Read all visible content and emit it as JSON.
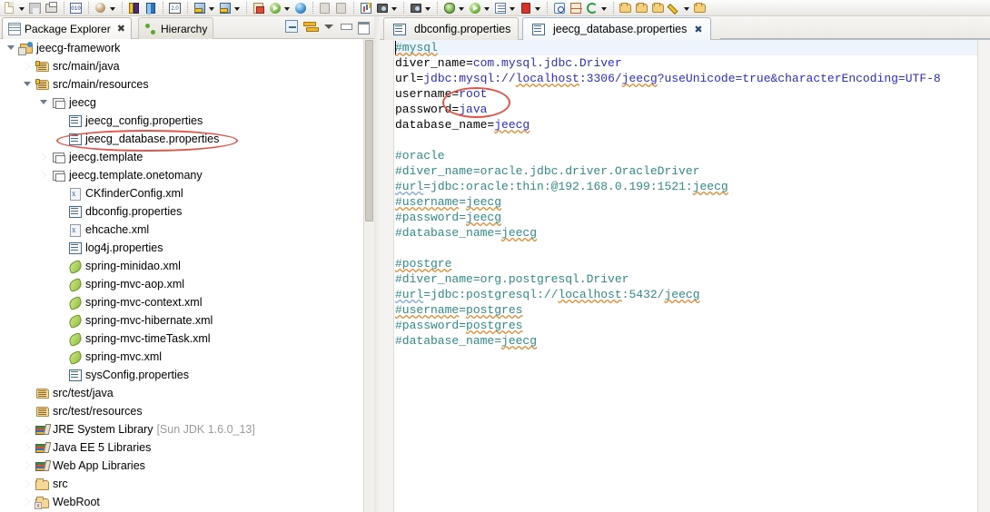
{
  "toolbar": {
    "groups": [
      {
        "items": [
          {
            "icon": "new-file-icon",
            "arrow": true
          },
          {
            "icon": "save-icon",
            "arrow": false
          },
          {
            "icon": "print-icon",
            "arrow": false
          }
        ]
      },
      {
        "items": [
          {
            "icon": "binary-010-icon",
            "arrow": false
          }
        ]
      },
      {
        "items": [
          {
            "icon": "package-ball-icon",
            "arrow": true
          }
        ]
      },
      {
        "items": [
          {
            "icon": "book-yellow-purple-icon",
            "arrow": false
          },
          {
            "icon": "book-blue-icon",
            "arrow": false
          }
        ]
      },
      {
        "items": [
          {
            "icon": "version-2-0-icon",
            "arrow": false
          }
        ]
      },
      {
        "items": [
          {
            "icon": "new-java-class-icon",
            "arrow": true
          },
          {
            "icon": "new-java-project-icon",
            "arrow": true
          }
        ]
      },
      {
        "items": [
          {
            "icon": "new-wizard-icon",
            "arrow": false
          },
          {
            "icon": "run-server-icon",
            "arrow": true
          },
          {
            "icon": "open-browser-icon",
            "arrow": false
          }
        ]
      },
      {
        "items": [
          {
            "icon": "grey-disabled-icon",
            "arrow": false
          },
          {
            "icon": "grey-disabled-2-icon",
            "arrow": false
          }
        ]
      },
      {
        "items": [
          {
            "icon": "chart-icon",
            "arrow": false
          },
          {
            "icon": "camera-icon",
            "arrow": true
          }
        ]
      },
      {
        "items": [
          {
            "icon": "device-icon",
            "arrow": true
          }
        ]
      },
      {
        "items": [
          {
            "icon": "debug-bug-icon",
            "arrow": true
          },
          {
            "icon": "run-green-icon",
            "arrow": true
          },
          {
            "icon": "external-tools-icon",
            "arrow": true
          },
          {
            "icon": "lock-red-icon",
            "arrow": true
          }
        ]
      },
      {
        "items": [
          {
            "icon": "search-icon",
            "arrow": false
          },
          {
            "icon": "grid-icon",
            "arrow": false
          },
          {
            "icon": "refresh-green-icon",
            "arrow": true
          }
        ]
      },
      {
        "items": [
          {
            "icon": "open-folder-icon",
            "arrow": false
          },
          {
            "icon": "open-folder-2-icon",
            "arrow": false
          },
          {
            "icon": "open-folder-3-icon",
            "arrow": false
          },
          {
            "icon": "pencil-icon",
            "arrow": true
          },
          {
            "icon": "open-folder-4-icon",
            "arrow": false
          }
        ]
      }
    ]
  },
  "left_panel": {
    "tabs": [
      {
        "label": "Package Explorer",
        "icon": "package-explorer-icon",
        "active": true,
        "closable": true
      },
      {
        "label": "Hierarchy",
        "icon": "hierarchy-icon",
        "active": false,
        "closable": false
      }
    ],
    "toolbar_buttons": [
      {
        "name": "collapse-all-button",
        "tooltip": "Collapse All"
      },
      {
        "name": "link-with-editor-button",
        "tooltip": "Link with Editor"
      },
      {
        "name": "view-menu-button",
        "tooltip": "View Menu"
      },
      {
        "name": "minimize-button",
        "tooltip": "Minimize"
      },
      {
        "name": "maximize-button",
        "tooltip": "Maximize"
      }
    ],
    "tree": [
      {
        "label": "jeecg-framework",
        "indent": 0,
        "twisty": "open",
        "icon": "java-project-icon"
      },
      {
        "label": "src/main/java",
        "indent": 1,
        "twisty": "closed",
        "icon": "source-folder-icon"
      },
      {
        "label": "src/main/resources",
        "indent": 1,
        "twisty": "open",
        "icon": "source-folder-icon"
      },
      {
        "label": "jeecg",
        "indent": 2,
        "twisty": "open",
        "icon": "package-icon"
      },
      {
        "label": "jeecg_config.properties",
        "indent": 3,
        "twisty": "none",
        "icon": "properties-file-icon"
      },
      {
        "label": "jeecg_database.properties",
        "indent": 3,
        "twisty": "none",
        "icon": "properties-file-icon",
        "selected": true
      },
      {
        "label": "jeecg.template",
        "indent": 2,
        "twisty": "closed",
        "icon": "package-icon"
      },
      {
        "label": "jeecg.template.onetomany",
        "indent": 2,
        "twisty": "closed",
        "icon": "package-icon"
      },
      {
        "label": "CKfinderConfig.xml",
        "indent": 3,
        "twisty": "none",
        "icon": "xml-file-icon"
      },
      {
        "label": "dbconfig.properties",
        "indent": 3,
        "twisty": "none",
        "icon": "properties-file-icon"
      },
      {
        "label": "ehcache.xml",
        "indent": 3,
        "twisty": "none",
        "icon": "xml-file-icon"
      },
      {
        "label": "log4j.properties",
        "indent": 3,
        "twisty": "none",
        "icon": "properties-file-icon"
      },
      {
        "label": "spring-minidao.xml",
        "indent": 3,
        "twisty": "none",
        "icon": "spring-file-icon"
      },
      {
        "label": "spring-mvc-aop.xml",
        "indent": 3,
        "twisty": "none",
        "icon": "spring-file-icon"
      },
      {
        "label": "spring-mvc-context.xml",
        "indent": 3,
        "twisty": "none",
        "icon": "spring-file-icon"
      },
      {
        "label": "spring-mvc-hibernate.xml",
        "indent": 3,
        "twisty": "none",
        "icon": "spring-file-icon"
      },
      {
        "label": "spring-mvc-timeTask.xml",
        "indent": 3,
        "twisty": "none",
        "icon": "spring-file-icon"
      },
      {
        "label": "spring-mvc.xml",
        "indent": 3,
        "twisty": "none",
        "icon": "spring-file-icon"
      },
      {
        "label": "sysConfig.properties",
        "indent": 3,
        "twisty": "none",
        "icon": "properties-file-icon"
      },
      {
        "label": "src/test/java",
        "indent": 1,
        "twisty": "none",
        "icon": "source-folder-plain-icon"
      },
      {
        "label": "src/test/resources",
        "indent": 1,
        "twisty": "none",
        "icon": "source-folder-plain-icon"
      },
      {
        "label": "JRE System Library",
        "suffix": "[Sun JDK 1.6.0_13]",
        "indent": 1,
        "twisty": "closed",
        "icon": "library-icon"
      },
      {
        "label": "Java EE 5 Libraries",
        "indent": 1,
        "twisty": "closed",
        "icon": "library-icon"
      },
      {
        "label": "Web App Libraries",
        "indent": 1,
        "twisty": "closed",
        "icon": "library-icon"
      },
      {
        "label": "src",
        "indent": 1,
        "twisty": "closed",
        "icon": "folder-icon"
      },
      {
        "label": "WebRoot",
        "indent": 1,
        "twisty": "closed",
        "icon": "web-folder-icon"
      }
    ]
  },
  "editor": {
    "tabs": [
      {
        "label": "dbconfig.properties",
        "icon": "properties-file-icon",
        "active": false,
        "closable": false
      },
      {
        "label": "jeecg_database.properties",
        "icon": "properties-file-icon",
        "active": true,
        "closable": true
      }
    ],
    "lines": [
      {
        "current": true,
        "caret": true,
        "tokens": [
          {
            "t": "#mysql",
            "c": "cmt",
            "sq": true
          }
        ]
      },
      {
        "tokens": [
          {
            "t": "diver_name=",
            "c": "key"
          },
          {
            "t": "com.mysql.jdbc.Driver",
            "c": "val"
          }
        ]
      },
      {
        "tokens": [
          {
            "t": "url=",
            "c": "key"
          },
          {
            "t": "jdbc:mysql://",
            "c": "val"
          },
          {
            "t": "localhost",
            "c": "val",
            "sq": true
          },
          {
            "t": ":3306/",
            "c": "val"
          },
          {
            "t": "jeecg",
            "c": "val",
            "sq": true
          },
          {
            "t": "?useUnicode=true&characterEncoding=UTF-8",
            "c": "val"
          }
        ]
      },
      {
        "tokens": [
          {
            "t": "username=",
            "c": "key"
          },
          {
            "t": "root",
            "c": "val"
          }
        ]
      },
      {
        "tokens": [
          {
            "t": "password=",
            "c": "key"
          },
          {
            "t": "java",
            "c": "val"
          }
        ]
      },
      {
        "tokens": [
          {
            "t": "database_name=",
            "c": "key"
          },
          {
            "t": "jeecg",
            "c": "val",
            "sq": true
          }
        ]
      },
      {
        "tokens": []
      },
      {
        "tokens": [
          {
            "t": "#oracle",
            "c": "cmt"
          }
        ]
      },
      {
        "tokens": [
          {
            "t": "#diver_name=oracle.jdbc.driver.OracleDriver",
            "c": "cmt"
          }
        ]
      },
      {
        "tokens": [
          {
            "t": "#url",
            "c": "cmt",
            "sqb": true
          },
          {
            "t": "=jdbc:oracle:thin:@192.168.0.199:1521:",
            "c": "cmt"
          },
          {
            "t": "jeecg",
            "c": "cmt",
            "sq": true
          }
        ]
      },
      {
        "tokens": [
          {
            "t": "#username",
            "c": "cmt",
            "sq": true
          },
          {
            "t": "=",
            "c": "cmt"
          },
          {
            "t": "jeecg",
            "c": "cmt",
            "sq": true
          }
        ]
      },
      {
        "tokens": [
          {
            "t": "#password=",
            "c": "cmt"
          },
          {
            "t": "jeecg",
            "c": "cmt",
            "sq": true
          }
        ]
      },
      {
        "tokens": [
          {
            "t": "#database_name=",
            "c": "cmt"
          },
          {
            "t": "jeecg",
            "c": "cmt",
            "sq": true
          }
        ]
      },
      {
        "tokens": []
      },
      {
        "tokens": [
          {
            "t": "#postgre",
            "c": "cmt",
            "sq": true
          }
        ]
      },
      {
        "tokens": [
          {
            "t": "#diver_name=org.postgresql.Driver",
            "c": "cmt"
          }
        ]
      },
      {
        "tokens": [
          {
            "t": "#url",
            "c": "cmt",
            "sqb": true
          },
          {
            "t": "=jdbc:postgresql://",
            "c": "cmt"
          },
          {
            "t": "localhost",
            "c": "cmt",
            "sq": true
          },
          {
            "t": ":5432/",
            "c": "cmt"
          },
          {
            "t": "jeecg",
            "c": "cmt",
            "sq": true
          }
        ]
      },
      {
        "tokens": [
          {
            "t": "#username",
            "c": "cmt",
            "sq": true
          },
          {
            "t": "=",
            "c": "cmt"
          },
          {
            "t": "postgres",
            "c": "cmt",
            "sq": true
          }
        ]
      },
      {
        "tokens": [
          {
            "t": "#password=",
            "c": "cmt"
          },
          {
            "t": "postgres",
            "c": "cmt",
            "sq": true
          }
        ]
      },
      {
        "tokens": [
          {
            "t": "#database_name=",
            "c": "cmt"
          },
          {
            "t": "jeecg",
            "c": "cmt",
            "sq": true
          }
        ]
      }
    ]
  },
  "annotations": [
    {
      "name": "tree-file-highlight-ellipse",
      "color": "#e2564a"
    },
    {
      "name": "credentials-highlight-ellipse",
      "color": "#e2564a"
    }
  ],
  "colors": {
    "comment": "#2e8b8b",
    "value": "#2b2bd6",
    "key": "#000000",
    "current_line": "#edf4fb",
    "annotation": "#e2564a",
    "dim_text": "#9a9a9a"
  }
}
